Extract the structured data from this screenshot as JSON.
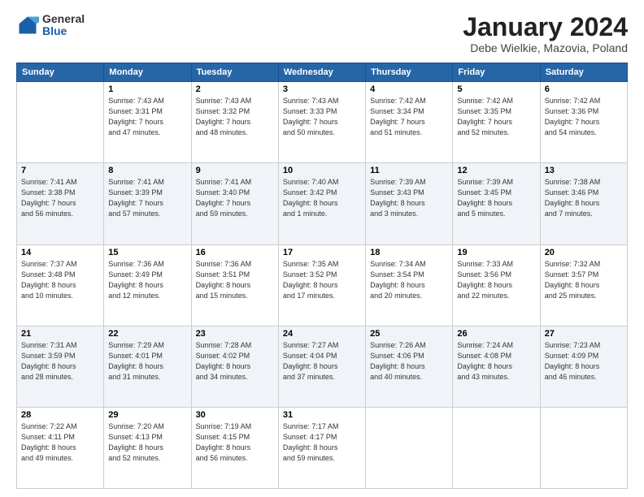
{
  "logo": {
    "general": "General",
    "blue": "Blue"
  },
  "header": {
    "month": "January 2024",
    "location": "Debe Wielkie, Mazovia, Poland"
  },
  "weekdays": [
    "Sunday",
    "Monday",
    "Tuesday",
    "Wednesday",
    "Thursday",
    "Friday",
    "Saturday"
  ],
  "weeks": [
    [
      {
        "date": "",
        "info": ""
      },
      {
        "date": "1",
        "info": "Sunrise: 7:43 AM\nSunset: 3:31 PM\nDaylight: 7 hours\nand 47 minutes."
      },
      {
        "date": "2",
        "info": "Sunrise: 7:43 AM\nSunset: 3:32 PM\nDaylight: 7 hours\nand 48 minutes."
      },
      {
        "date": "3",
        "info": "Sunrise: 7:43 AM\nSunset: 3:33 PM\nDaylight: 7 hours\nand 50 minutes."
      },
      {
        "date": "4",
        "info": "Sunrise: 7:42 AM\nSunset: 3:34 PM\nDaylight: 7 hours\nand 51 minutes."
      },
      {
        "date": "5",
        "info": "Sunrise: 7:42 AM\nSunset: 3:35 PM\nDaylight: 7 hours\nand 52 minutes."
      },
      {
        "date": "6",
        "info": "Sunrise: 7:42 AM\nSunset: 3:36 PM\nDaylight: 7 hours\nand 54 minutes."
      }
    ],
    [
      {
        "date": "7",
        "info": "Sunrise: 7:41 AM\nSunset: 3:38 PM\nDaylight: 7 hours\nand 56 minutes."
      },
      {
        "date": "8",
        "info": "Sunrise: 7:41 AM\nSunset: 3:39 PM\nDaylight: 7 hours\nand 57 minutes."
      },
      {
        "date": "9",
        "info": "Sunrise: 7:41 AM\nSunset: 3:40 PM\nDaylight: 7 hours\nand 59 minutes."
      },
      {
        "date": "10",
        "info": "Sunrise: 7:40 AM\nSunset: 3:42 PM\nDaylight: 8 hours\nand 1 minute."
      },
      {
        "date": "11",
        "info": "Sunrise: 7:39 AM\nSunset: 3:43 PM\nDaylight: 8 hours\nand 3 minutes."
      },
      {
        "date": "12",
        "info": "Sunrise: 7:39 AM\nSunset: 3:45 PM\nDaylight: 8 hours\nand 5 minutes."
      },
      {
        "date": "13",
        "info": "Sunrise: 7:38 AM\nSunset: 3:46 PM\nDaylight: 8 hours\nand 7 minutes."
      }
    ],
    [
      {
        "date": "14",
        "info": "Sunrise: 7:37 AM\nSunset: 3:48 PM\nDaylight: 8 hours\nand 10 minutes."
      },
      {
        "date": "15",
        "info": "Sunrise: 7:36 AM\nSunset: 3:49 PM\nDaylight: 8 hours\nand 12 minutes."
      },
      {
        "date": "16",
        "info": "Sunrise: 7:36 AM\nSunset: 3:51 PM\nDaylight: 8 hours\nand 15 minutes."
      },
      {
        "date": "17",
        "info": "Sunrise: 7:35 AM\nSunset: 3:52 PM\nDaylight: 8 hours\nand 17 minutes."
      },
      {
        "date": "18",
        "info": "Sunrise: 7:34 AM\nSunset: 3:54 PM\nDaylight: 8 hours\nand 20 minutes."
      },
      {
        "date": "19",
        "info": "Sunrise: 7:33 AM\nSunset: 3:56 PM\nDaylight: 8 hours\nand 22 minutes."
      },
      {
        "date": "20",
        "info": "Sunrise: 7:32 AM\nSunset: 3:57 PM\nDaylight: 8 hours\nand 25 minutes."
      }
    ],
    [
      {
        "date": "21",
        "info": "Sunrise: 7:31 AM\nSunset: 3:59 PM\nDaylight: 8 hours\nand 28 minutes."
      },
      {
        "date": "22",
        "info": "Sunrise: 7:29 AM\nSunset: 4:01 PM\nDaylight: 8 hours\nand 31 minutes."
      },
      {
        "date": "23",
        "info": "Sunrise: 7:28 AM\nSunset: 4:02 PM\nDaylight: 8 hours\nand 34 minutes."
      },
      {
        "date": "24",
        "info": "Sunrise: 7:27 AM\nSunset: 4:04 PM\nDaylight: 8 hours\nand 37 minutes."
      },
      {
        "date": "25",
        "info": "Sunrise: 7:26 AM\nSunset: 4:06 PM\nDaylight: 8 hours\nand 40 minutes."
      },
      {
        "date": "26",
        "info": "Sunrise: 7:24 AM\nSunset: 4:08 PM\nDaylight: 8 hours\nand 43 minutes."
      },
      {
        "date": "27",
        "info": "Sunrise: 7:23 AM\nSunset: 4:09 PM\nDaylight: 8 hours\nand 46 minutes."
      }
    ],
    [
      {
        "date": "28",
        "info": "Sunrise: 7:22 AM\nSunset: 4:11 PM\nDaylight: 8 hours\nand 49 minutes."
      },
      {
        "date": "29",
        "info": "Sunrise: 7:20 AM\nSunset: 4:13 PM\nDaylight: 8 hours\nand 52 minutes."
      },
      {
        "date": "30",
        "info": "Sunrise: 7:19 AM\nSunset: 4:15 PM\nDaylight: 8 hours\nand 56 minutes."
      },
      {
        "date": "31",
        "info": "Sunrise: 7:17 AM\nSunset: 4:17 PM\nDaylight: 8 hours\nand 59 minutes."
      },
      {
        "date": "",
        "info": ""
      },
      {
        "date": "",
        "info": ""
      },
      {
        "date": "",
        "info": ""
      }
    ]
  ]
}
